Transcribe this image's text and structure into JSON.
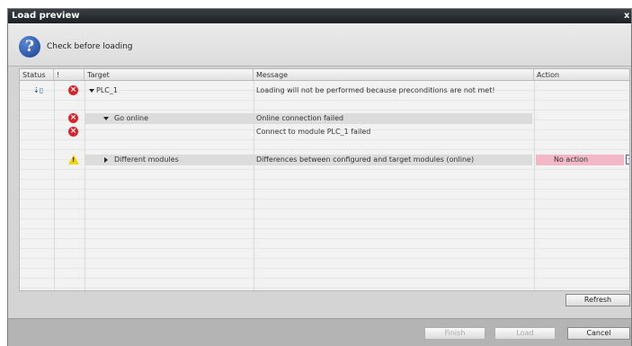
{
  "dialog": {
    "title": "Load preview",
    "close_glyph": "x",
    "header_text": "Check before loading",
    "header_icon": "question-icon"
  },
  "columns": [
    "Status",
    "!",
    "Target",
    "Message",
    "Action"
  ],
  "rows": [
    {
      "target": "PLC_1",
      "message": "Loading will not be performed because preconditions are not met!",
      "status_icon": "download-status-icon",
      "flag": "error-icon"
    },
    {
      "target": "Go online",
      "message": "Online connection failed",
      "flag": "error-icon"
    },
    {
      "target": "",
      "message": "Connect to module PLC_1 failed",
      "flag": "error-icon"
    },
    {
      "target": "Different modules",
      "message": "Differences between configured and target modules (online)",
      "flag": "warning-icon",
      "action": "No action"
    }
  ],
  "buttons": {
    "refresh": "Refresh",
    "finish": "Finish",
    "load": "Load",
    "cancel": "Cancel"
  },
  "colors": {
    "error": "#d9232b",
    "warning": "#f2d400",
    "action_highlight": "#f2b8c8"
  }
}
